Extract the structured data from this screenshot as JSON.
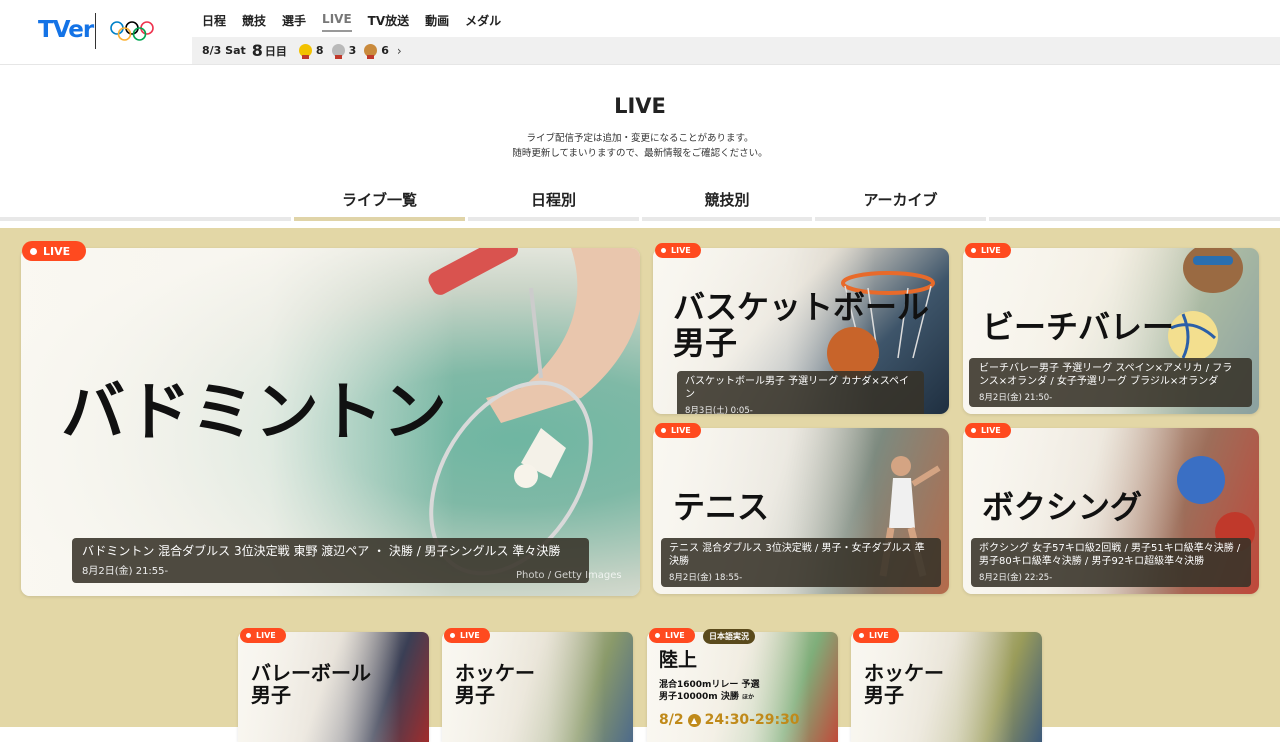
{
  "header": {
    "logo_text": "TVer",
    "nav": [
      "日程",
      "競技",
      "選手",
      "LIVE",
      "TV放送",
      "動画",
      "メダル"
    ],
    "active_nav_index": 3,
    "medal_bar": {
      "date": "8/3 Sat",
      "day": "8",
      "day_label": "日目",
      "gold": "8",
      "silver": "3",
      "bronze": "6",
      "arrow": "›"
    }
  },
  "page": {
    "title": "LIVE",
    "notice_line1": "ライブ配信予定は追加・変更になることがあります。",
    "notice_line2": "随時更新してまいりますので、最新情報をご確認ください。"
  },
  "tabs": [
    {
      "label": "ライブ一覧",
      "active": true
    },
    {
      "label": "日程別",
      "active": false
    },
    {
      "label": "競技別",
      "active": false
    },
    {
      "label": "アーカイブ",
      "active": false
    }
  ],
  "live_badge_text": "LIVE",
  "cards": {
    "badminton": {
      "title": "バドミントン",
      "desc": "バドミントン 混合ダブルス 3位決定戦 東野 渡辺ペア ・ 決勝 / 男子シングルス 準々決勝",
      "when": "8月2日(金) 21:55-",
      "credit": "Photo / Getty Images"
    },
    "basketball": {
      "title_line1": "バスケットボール",
      "title_line2": "男子",
      "desc": "バスケットボール男子 予選リーグ カナダ×スペイン",
      "when": "8月3日(土) 0:05-"
    },
    "beachvolley": {
      "title": "ビーチバレー",
      "desc": "ビーチバレー男子 予選リーグ スペイン×アメリカ / フランス×オランダ / 女子予選リーグ ブラジル×オランダ",
      "when": "8月2日(金) 21:50-"
    },
    "tennis": {
      "title": "テニス",
      "desc": "テニス 混合ダブルス 3位決定戦 / 男子・女子ダブルス 準決勝",
      "when": "8月2日(金) 18:55-"
    },
    "boxing": {
      "title": "ボクシング",
      "desc": "ボクシング 女子57キロ級2回戦 / 男子51キロ級準々決勝 / 男子80キロ級準々決勝 / 男子92キロ超級準々決勝",
      "when": "8月2日(金) 22:25-"
    },
    "volleyball": {
      "title_line1": "バレーボール",
      "title_line2": "男子"
    },
    "hockey1": {
      "title_line1": "ホッケー",
      "title_line2": "男子"
    },
    "athletics": {
      "jp_badge": "日本語実況",
      "title": "陸上",
      "sub_line1": "混合1600mリレー 予選",
      "sub_line2": "男子10000m 決勝",
      "sub_more": "ほか",
      "date": "8/2",
      "time": "24:30-29:30"
    },
    "hockey2": {
      "title_line1": "ホッケー",
      "title_line2": "男子"
    }
  },
  "colors": {
    "live": "#ff4a1f",
    "content_bg": "#e3d7a6",
    "brand": "#1473e6"
  }
}
